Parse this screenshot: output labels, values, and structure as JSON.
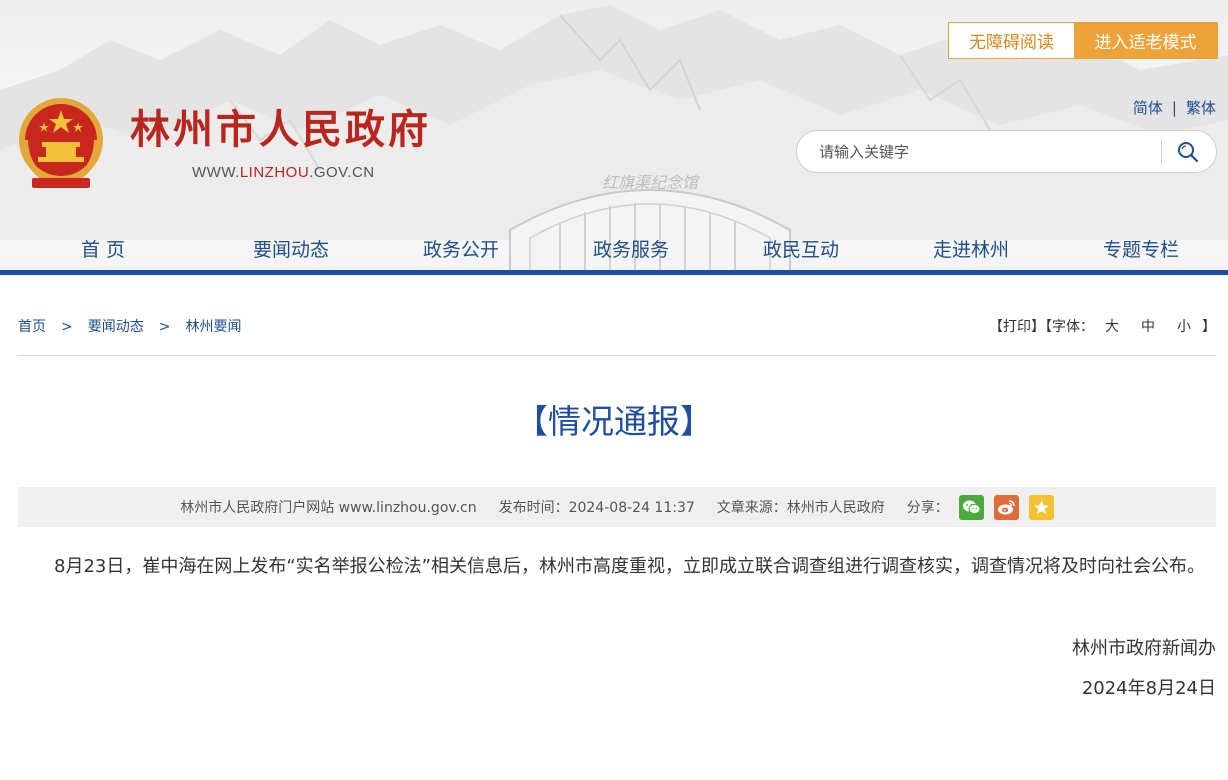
{
  "header": {
    "site_title": "林州市人民政府",
    "site_url_prefix": "WWW.",
    "site_url_highlight": "LINZHOU",
    "site_url_suffix": ".GOV.CN",
    "accessible_label": "无障碍阅读",
    "elder_mode_label": "进入适老模式",
    "lang_simplified": "简体",
    "lang_separator": "|",
    "lang_traditional": "繁体",
    "search_placeholder": "请输入关键字",
    "building_sign": "红旗渠纪念馆"
  },
  "nav": {
    "items": [
      "首  页",
      "要闻动态",
      "政务公开",
      "政务服务",
      "政民互动",
      "走进林州",
      "专题专栏"
    ]
  },
  "breadcrumb": {
    "home": "首页",
    "level1": "要闻动态",
    "level2": "林州要闻",
    "separator": ">"
  },
  "tools": {
    "print_label": "【打印】",
    "font_prefix": "【字体：",
    "font_large": "大",
    "font_medium": "中",
    "font_small": "小",
    "font_suffix": "】"
  },
  "article": {
    "title": "【情况通报】",
    "meta_site": "林州市人民政府门户网站 www.linzhou.gov.cn",
    "meta_publish": "发布时间：2024-08-24 11:37",
    "meta_source": "文章来源：林州市人民政府",
    "meta_share": "分享：",
    "body": "8月23日，崔中海在网上发布“实名举报公检法”相关信息后，林州市高度重视，立即成立联合调查组进行调查核实，调查情况将及时向社会公布。",
    "signature": "林州市政府新闻办",
    "date": "2024年8月24日"
  },
  "colors": {
    "brand_red": "#b8261d",
    "nav_blue": "#1f4e8c",
    "title_blue": "#1f4ea0",
    "accent_orange": "#eea33a"
  },
  "icons": {
    "emblem": "national-emblem-icon",
    "search": "search-icon",
    "share": [
      "wechat-icon",
      "weibo-icon",
      "favorite-star-icon"
    ]
  }
}
